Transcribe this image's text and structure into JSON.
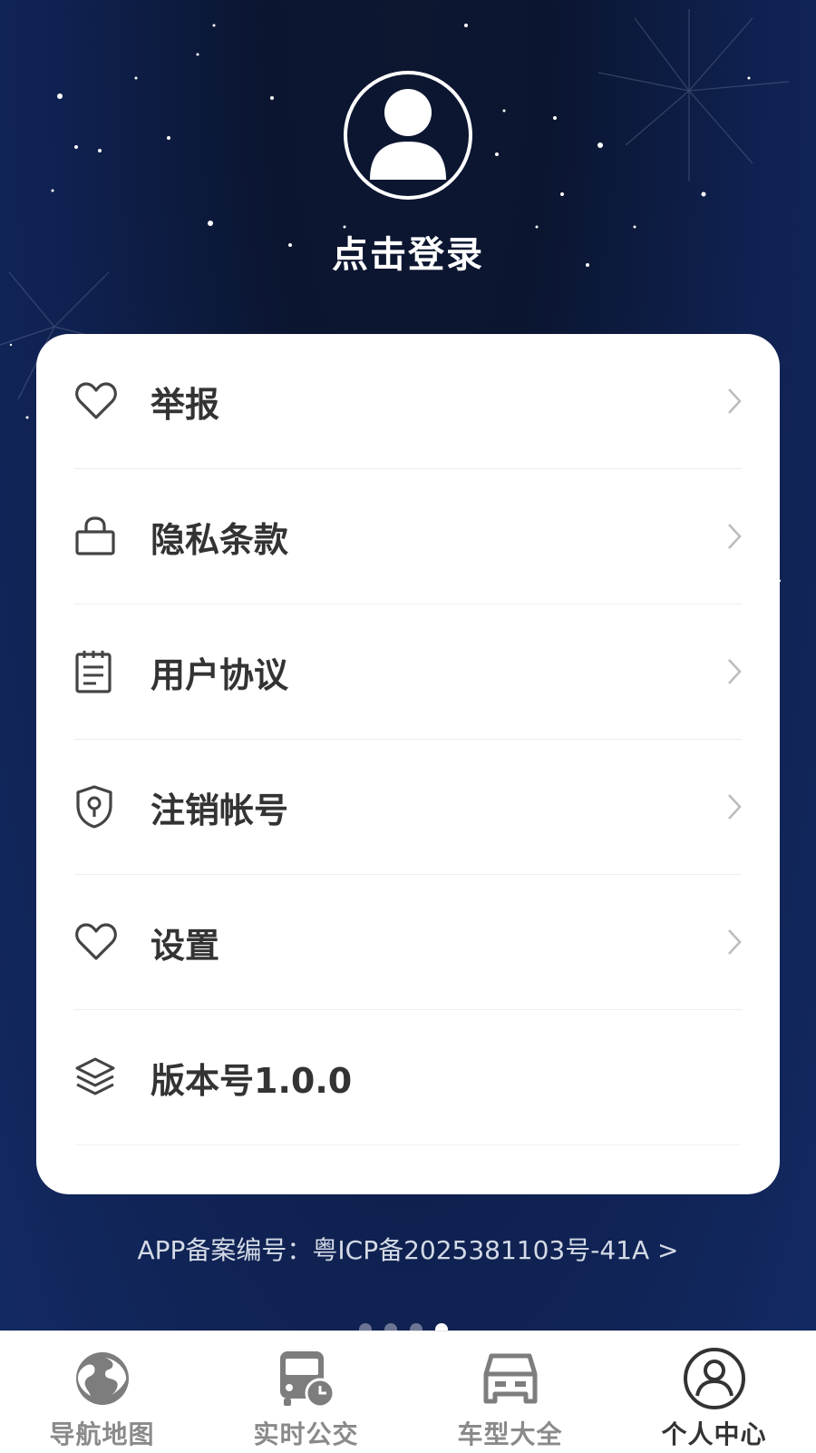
{
  "profile": {
    "login_text": "点击登录"
  },
  "menu": [
    {
      "label": "举报",
      "icon": "heart-icon"
    },
    {
      "label": "隐私条款",
      "icon": "bag-icon"
    },
    {
      "label": "用户协议",
      "icon": "notepad-icon"
    },
    {
      "label": "注销帐号",
      "icon": "shield-keyhole-icon"
    },
    {
      "label": "设置",
      "icon": "heart-icon"
    },
    {
      "label": "版本号1.0.0",
      "icon": "layers-icon"
    }
  ],
  "icp_text": "APP备案编号：粤ICP备2025381103号-41A >",
  "pager": {
    "count": 4,
    "active": 4
  },
  "tabs": [
    {
      "label": "导航地图",
      "icon": "globe-icon"
    },
    {
      "label": "实时公交",
      "icon": "bus-clock-icon"
    },
    {
      "label": "车型大全",
      "icon": "car-icon"
    },
    {
      "label": "个人中心",
      "icon": "person-icon",
      "active": true
    }
  ]
}
